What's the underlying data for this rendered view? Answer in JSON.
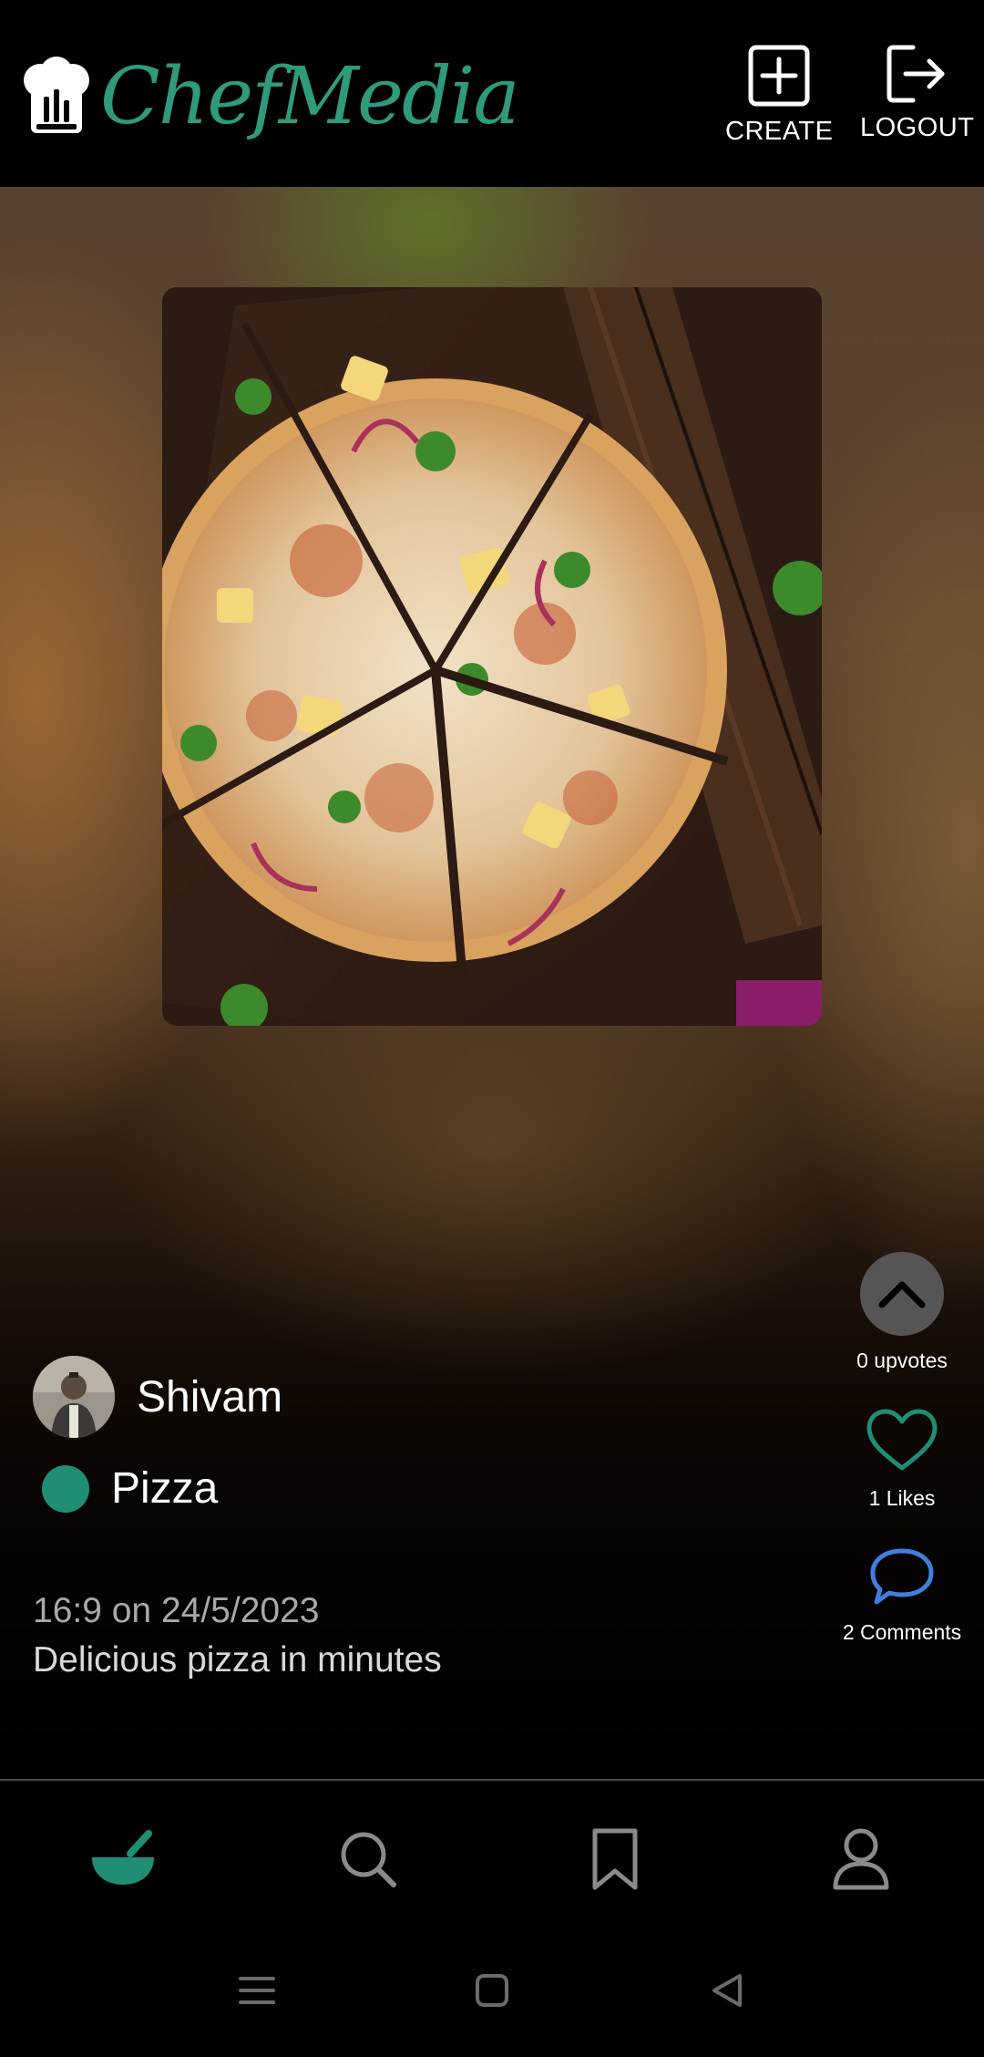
{
  "header": {
    "brand": "ChefMedia",
    "create_label": "CREATE",
    "logout_label": "LOGOUT"
  },
  "post": {
    "author": "Shivam",
    "category": "Pizza",
    "timestamp": "16:9 on 24/5/2023",
    "description": "Delicious pizza in minutes",
    "upvotes_label": "0 upvotes",
    "likes_label": "1 Likes",
    "comments_label": "2 Comments"
  },
  "icons": {
    "logo": "chef-hat-icon",
    "create": "plus-square-icon",
    "logout": "logout-icon",
    "upvote": "chevron-up-icon",
    "like": "heart-icon",
    "comment": "comment-bubble-icon",
    "home": "mortar-bowl-icon",
    "search": "search-icon",
    "saved": "bookmark-icon",
    "profile": "user-icon"
  },
  "colors": {
    "brand": "#2f9a7c",
    "category_dot": "#1f8e75",
    "like_heart": "#1f8e75",
    "comment": "#3f7fe0",
    "upvote_bg": "#555555",
    "nav_active": "#1f8e75"
  }
}
